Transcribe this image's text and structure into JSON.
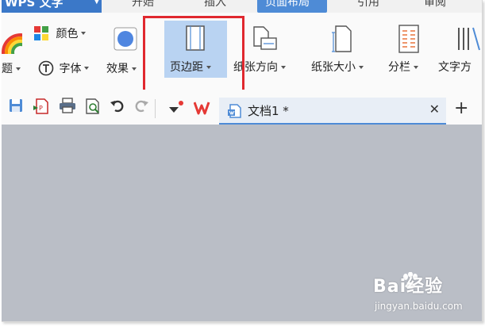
{
  "app": {
    "name": "WPS 文字"
  },
  "tabs": [
    {
      "label": "开始"
    },
    {
      "label": "插入"
    },
    {
      "label": "页面布局"
    },
    {
      "label": "引用"
    },
    {
      "label": "审阅"
    }
  ],
  "ribbon": {
    "color_label": "颜色",
    "theme_label": "题",
    "font_label": "字体",
    "effect_label": "效果",
    "margins_label": "页边距",
    "orientation_label": "纸张方向",
    "size_label": "纸张大小",
    "columns_label": "分栏",
    "text_direction_label": "文字方"
  },
  "document": {
    "tab_title": "文档1 *"
  },
  "watermark": {
    "brand": "Bai经验",
    "url": "jingyan.baidu.com"
  },
  "colors": {
    "accent": "#4e8bd6",
    "highlight_box": "#e0282f",
    "workspace": "#babec6"
  }
}
